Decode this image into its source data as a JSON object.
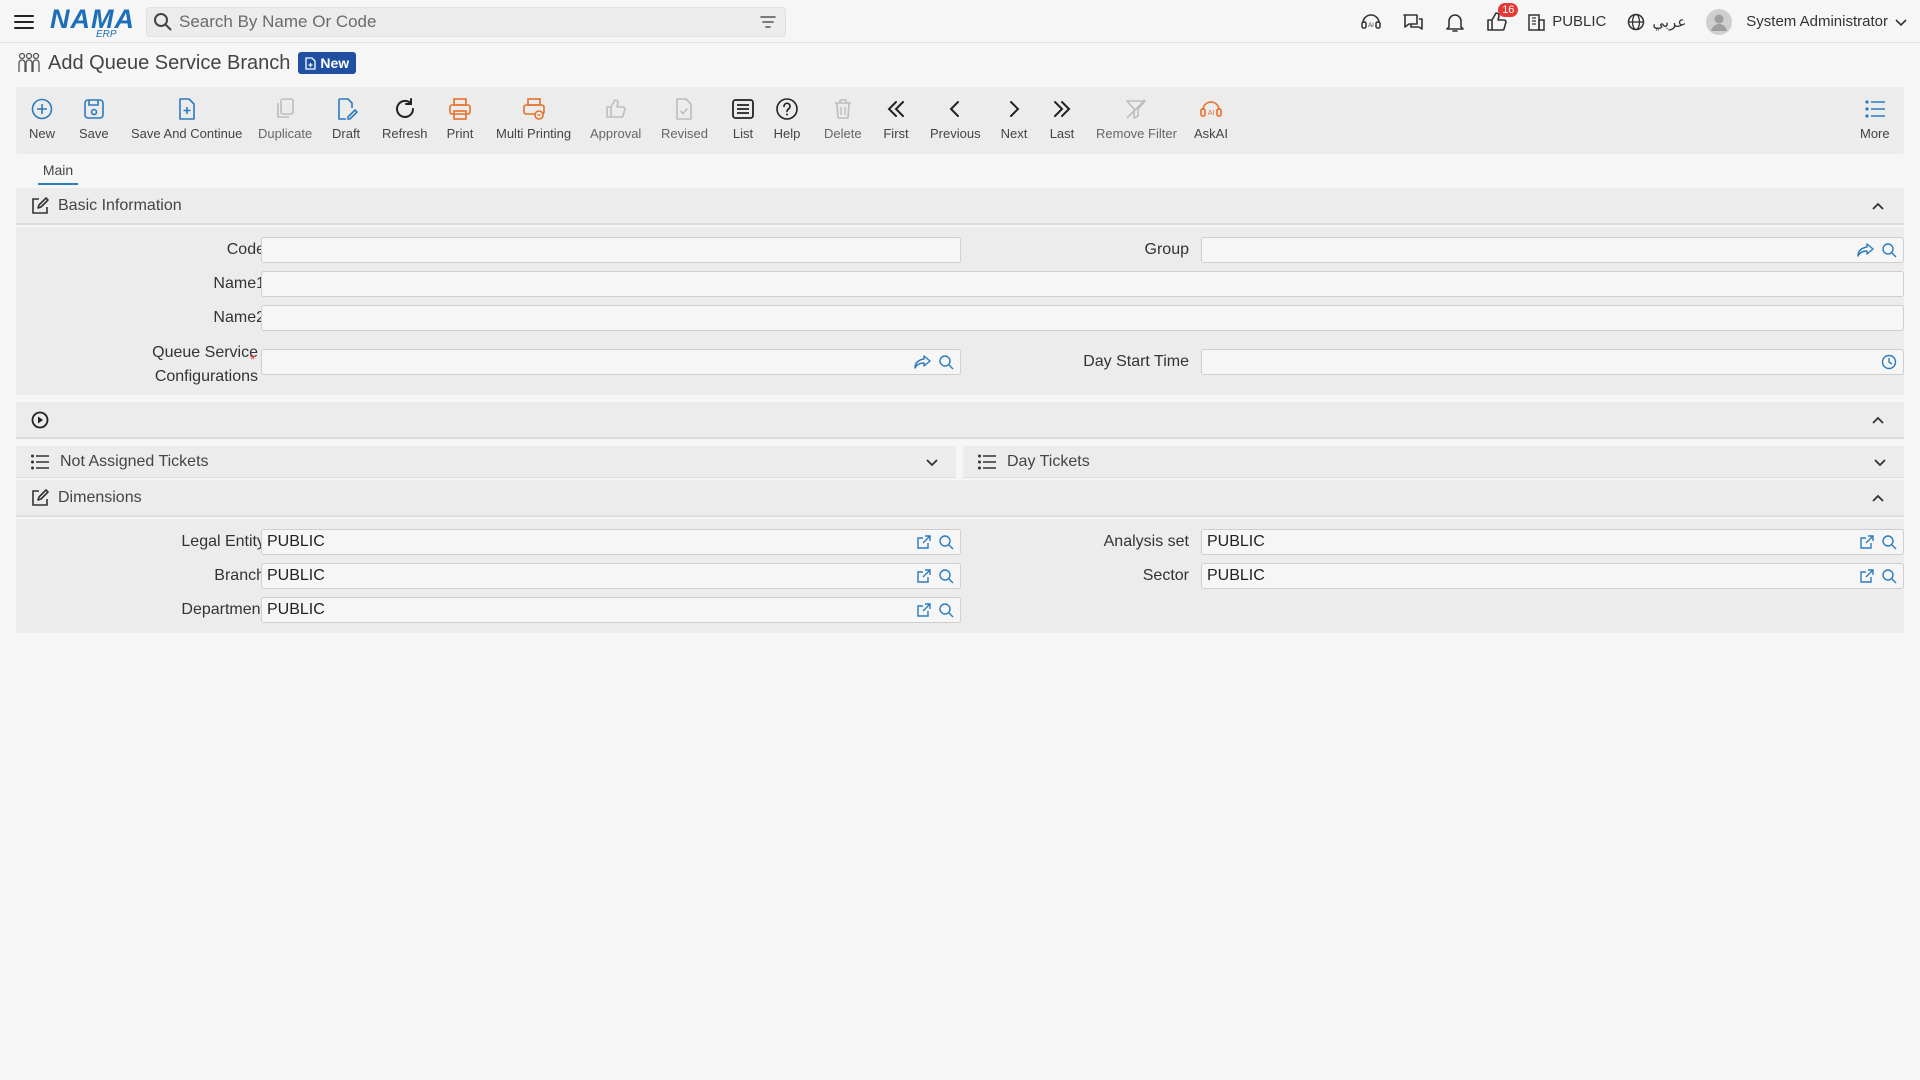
{
  "header": {
    "logo_main": "NAMA",
    "logo_sub": "ERP",
    "search_placeholder": "Search By Name Or Code",
    "notification_count": "16",
    "company": "PUBLIC",
    "language": "عربي",
    "user_name": "System Administrator"
  },
  "page": {
    "title": "Add Queue Service Branch",
    "status_badge": "New"
  },
  "toolbar": {
    "new": "New",
    "save": "Save",
    "save_continue": "Save And Continue",
    "duplicate": "Duplicate",
    "draft": "Draft",
    "refresh": "Refresh",
    "print": "Print",
    "multi_printing": "Multi Printing",
    "approval": "Approval",
    "revised": "Revised",
    "list": "List",
    "help": "Help",
    "delete": "Delete",
    "first": "First",
    "previous": "Previous",
    "next": "Next",
    "last": "Last",
    "remove_filter": "Remove Filter",
    "askai": "AskAI",
    "more": "More"
  },
  "tabs": {
    "main": "Main"
  },
  "basic_info": {
    "title": "Basic Information",
    "code_label": "Code",
    "code_value": "",
    "group_label": "Group",
    "group_value": "",
    "name1_label": "Name1",
    "name1_value": "",
    "name2_label": "Name2",
    "name2_value": "",
    "queue_config_label_1": "Queue Service",
    "queue_config_label_2": "Configurations",
    "queue_config_value": "",
    "day_start_label": "Day Start Time",
    "day_start_value": ""
  },
  "tickets": {
    "not_assigned": "Not Assigned Tickets",
    "day_tickets": "Day Tickets"
  },
  "dimensions": {
    "title": "Dimensions",
    "legal_entity_label": "Legal Entity",
    "legal_entity_value": "PUBLIC",
    "analysis_set_label": "Analysis set",
    "analysis_set_value": "PUBLIC",
    "branch_label": "Branch",
    "branch_value": "PUBLIC",
    "sector_label": "Sector",
    "sector_value": "PUBLIC",
    "department_label": "Department",
    "department_value": "PUBLIC"
  },
  "colors": {
    "accent": "#2b7bbf",
    "orange": "#e8702a",
    "badge": "#1f4fa3",
    "required": "#e53935"
  }
}
